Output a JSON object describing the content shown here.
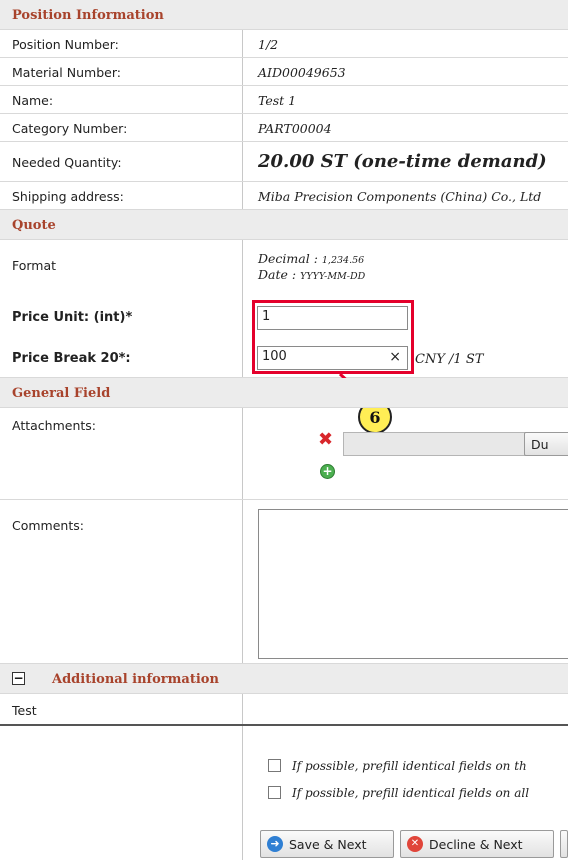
{
  "position_info": {
    "header": "Position Information",
    "fields": [
      {
        "label": "Position Number:",
        "value": "1/2"
      },
      {
        "label": "Material Number:",
        "value": "AID00049653"
      },
      {
        "label": "Name:",
        "value": "Test 1"
      },
      {
        "label": "Category Number:",
        "value": "PART00004"
      },
      {
        "label": "Needed Quantity:",
        "value": "20.00 ST (one-time demand)"
      },
      {
        "label": "Shipping address:",
        "value": "Miba Precision Components (China) Co., Ltd"
      }
    ]
  },
  "quote": {
    "header": "Quote",
    "format_label": "Format",
    "decimal_label": "Decimal :",
    "decimal_value": "1,234.56",
    "date_label": "Date :",
    "date_value": "YYYY-MM-DD",
    "price_unit_label": "Price Unit: (int)*",
    "price_unit_value": "1",
    "price_break_label": "Price Break 20*:",
    "price_break_value": "100",
    "clear_glyph": "×",
    "price_break_unit": "CNY /1 ST",
    "callout_number": "6"
  },
  "general_field": {
    "header": "General Field",
    "attachments_label": "Attachments:",
    "browse_label": "Du",
    "comments_label": "Comments:",
    "comments_value": ""
  },
  "additional": {
    "toggle_glyph": "−",
    "header": "Additional information",
    "test_label": "Test"
  },
  "prefill": {
    "option1": "If possible, prefill identical fields on th",
    "option2": "If possible, prefill identical fields on all"
  },
  "actions": {
    "save_next": "Save & Next",
    "decline_next": "Decline & Next"
  },
  "colors": {
    "section_text": "#a8432c",
    "callout_red": "#e4002b",
    "callout_fill": "#ffee55"
  }
}
